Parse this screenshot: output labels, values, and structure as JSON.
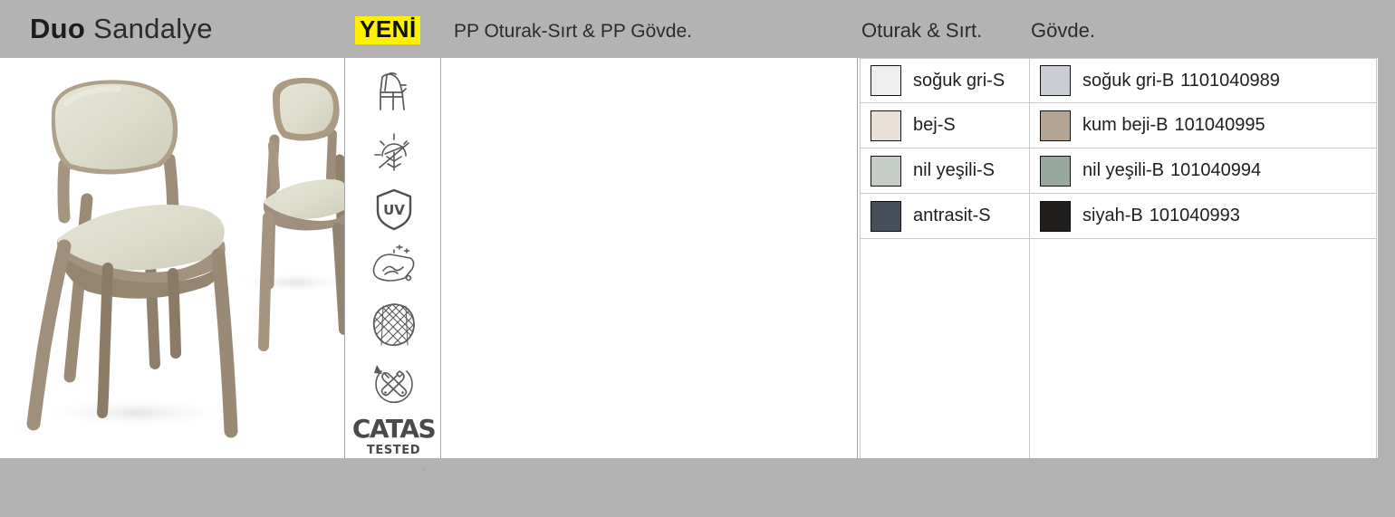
{
  "header": {
    "title_bold": "Duo",
    "title_light": "Sandalye",
    "badge": "YENİ",
    "subtitle": "PP Oturak-Sırt & PP Gövde.",
    "column1_title": "Oturak & Sırt.",
    "column2_title": "Gövde.",
    "badge_color": "#fff200",
    "bar_color": "#b3b3b3"
  },
  "product_image": {
    "alt": "Duo chair front view and rear view",
    "seat_color": "#dcdccb",
    "frame_color": "#a8967f"
  },
  "features": [
    {
      "name": "stackable-chair-icon",
      "label": "Stackable chair"
    },
    {
      "name": "weather-resistant-icon",
      "label": "Sun and frost resistant"
    },
    {
      "name": "uv-protection-icon",
      "label": "UV"
    },
    {
      "name": "easy-clean-icon",
      "label": "Easy to clean"
    },
    {
      "name": "textured-surface-icon",
      "label": "Textured surface"
    },
    {
      "name": "easy-maintenance-icon",
      "label": "Easy maintenance"
    }
  ],
  "certification": {
    "name": "catas-tested-icon",
    "word": "CATAS",
    "sub": "TESTED"
  },
  "seat_colors": {
    "heading": "Oturak & Sırt.",
    "rows": [
      {
        "label": "soğuk gri-S",
        "hex": "#eeeeee"
      },
      {
        "label": "bej-S",
        "hex": "#e9e1d7"
      },
      {
        "label": "nil yeşili-S",
        "hex": "#c5cdc6"
      },
      {
        "label": "antrasit-S",
        "hex": "#474f5a"
      }
    ]
  },
  "body_colors": {
    "heading": "Gövde.",
    "rows": [
      {
        "label": "soğuk gri-B",
        "code": "1101040989",
        "hex": "#cbcdd4"
      },
      {
        "label": "kum beji-B",
        "code": "101040995",
        "hex": "#b4a594"
      },
      {
        "label": "nil yeşili-B",
        "code": "101040994",
        "hex": "#99a89f"
      },
      {
        "label": "siyah-B",
        "code": "101040993",
        "hex": "#211f1e"
      }
    ]
  }
}
